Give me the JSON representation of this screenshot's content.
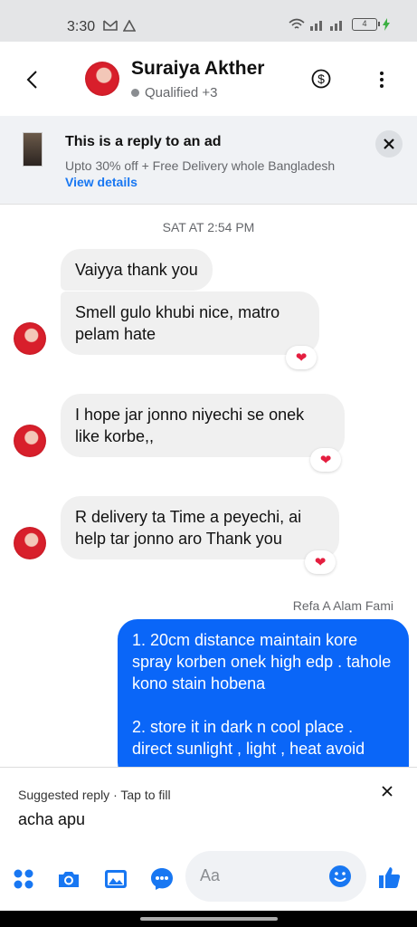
{
  "status_bar": {
    "time": "3:30",
    "battery": "4"
  },
  "header": {
    "name": "Suraiya Akther",
    "subtitle": "Qualified +3"
  },
  "ad": {
    "title": "This is a reply to an ad",
    "text": "Upto 30% off + Free Delivery whole Bangladesh",
    "link": "View details"
  },
  "conversation": {
    "timestamp": "SAT AT 2:54 PM",
    "incoming": [
      {
        "text": "Vaiyya thank you"
      },
      {
        "text": "Smell gulo khubi nice, matro pelam hate"
      },
      {
        "text": "I hope jar jonno niyechi se onek like korbe,,"
      },
      {
        "text": "R delivery ta Time a peyechi, ai help tar jonno aro Thank you"
      }
    ],
    "reaction": "❤",
    "sender_label": "Refa A Alam Fami",
    "outgoing": "1. 20cm distance maintain kore spray korben  onek high edp . tahole kono stain hobena\n\n2. store it in dark n cool place . direct sunlight , light , heat avoid"
  },
  "suggested_reply": {
    "label": "Suggested reply · Tap to fill",
    "reply": "acha apu"
  },
  "composer": {
    "placeholder": "Aa"
  },
  "colors": {
    "accent": "#1877f2",
    "outgoing_bubble": "#0a66f8",
    "reaction": "#e41e3f"
  }
}
